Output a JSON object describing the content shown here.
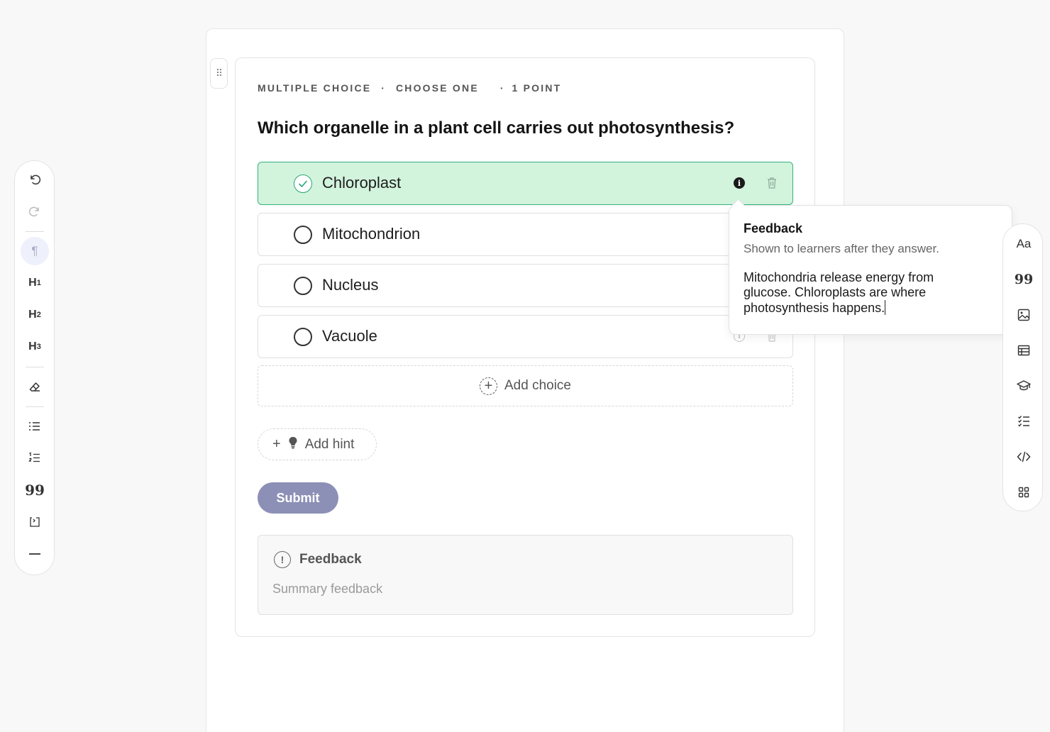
{
  "question": {
    "type_label": "MULTIPLE CHOICE",
    "mode_label": "CHOOSE ONE",
    "points_label": "1 POINT",
    "separator": "·",
    "text": "Which organelle in a plant cell carries out photosynthesis?",
    "choices": [
      {
        "label": "Chloroplast",
        "correct": true
      },
      {
        "label": "Mitochondrion",
        "correct": false
      },
      {
        "label": "Nucleus",
        "correct": false
      },
      {
        "label": "Vacuole",
        "correct": false
      }
    ],
    "add_choice_label": "Add choice",
    "add_hint_label": "Add hint",
    "submit_label": "Submit"
  },
  "summary_feedback": {
    "title": "Feedback",
    "placeholder": "Summary feedback"
  },
  "popover": {
    "title": "Feedback",
    "subtitle": "Shown to learners after they answer.",
    "body": "Mitochondria release energy from glucose. Chloroplasts are where photosynthesis happens."
  },
  "left_toolbar": {
    "items": [
      "undo-icon",
      "redo-icon",
      "paragraph-icon",
      "heading-1-icon",
      "heading-2-icon",
      "heading-3-icon",
      "eraser-icon",
      "bullet-list-icon",
      "numbered-list-icon",
      "quote-icon",
      "code-block-icon",
      "divider-icon"
    ],
    "active": "paragraph-icon"
  },
  "right_toolbar": {
    "items": [
      "font-icon",
      "quote-icon",
      "image-icon",
      "table-icon",
      "graduation-cap-icon",
      "checklist-icon",
      "code-icon",
      "grid-icon"
    ]
  },
  "colors": {
    "correct_bg": "#d2f3dc",
    "correct_border": "#33b37f",
    "submit_bg": "#8c90b6"
  }
}
